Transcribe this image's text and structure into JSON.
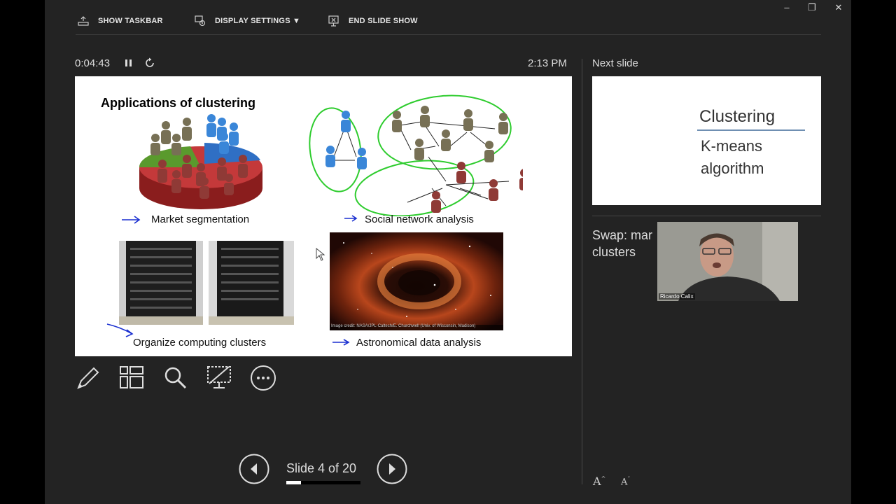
{
  "toolbar": {
    "show_taskbar": "SHOW TASKBAR",
    "display_settings": "DISPLAY SETTINGS ▼",
    "end_slide_show": "END SLIDE SHOW"
  },
  "window_controls": {
    "minimize": "–",
    "restore": "❐",
    "close": "✕"
  },
  "presenter": {
    "timer": "0:04:43",
    "clock": "2:13 PM"
  },
  "slide": {
    "title": "Applications of clustering",
    "labels": {
      "market": "Market segmentation",
      "social": "Social network analysis",
      "computing": "Organize computing clusters",
      "astro": "Astronomical data analysis"
    },
    "image_credit": "Image credit: NASA/JPL-Caltech/E. Churchwell (Univ. of Wisconsin, Madison)"
  },
  "navigation": {
    "counter": "Slide 4 of 20",
    "current": 4,
    "total": 20
  },
  "next_slide": {
    "label": "Next slide",
    "title": "Clustering",
    "subtitle": "K-means algorithm"
  },
  "notes": {
    "text": "Swap: mar clusters"
  },
  "webcam": {
    "name": "Ricardo Calix"
  },
  "font_controls": {
    "increase": "A",
    "decrease": "A"
  }
}
